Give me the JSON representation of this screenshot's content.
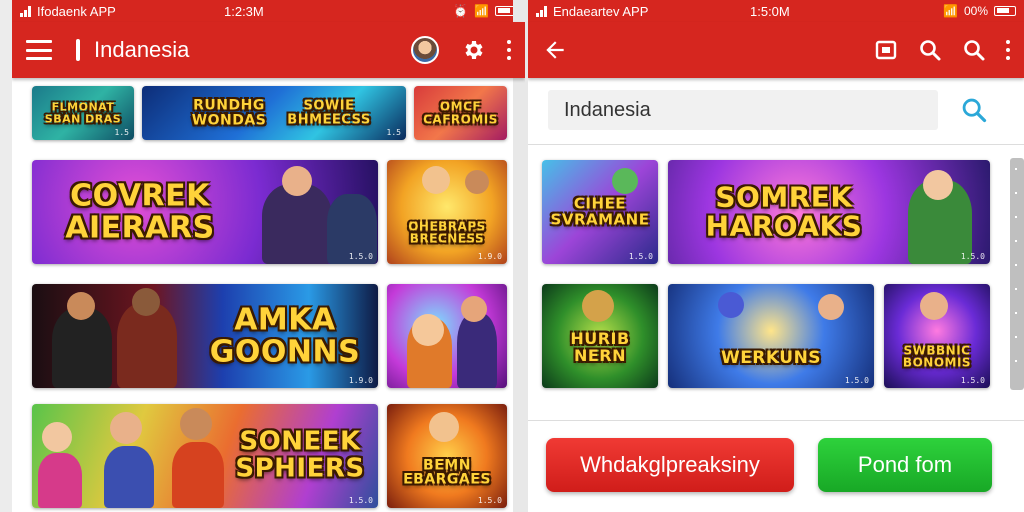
{
  "left_phone": {
    "status": {
      "app_label": "Ifodaenk APP",
      "time": "1:2:3M"
    },
    "appbar": {
      "title": "Indanesia",
      "menu_icon": "hamburger-icon",
      "settings_icon": "gear-icon",
      "more_icon": "kebab-icon"
    },
    "tiles": [
      {
        "title": "FLMONAT\nSBAN DRAS",
        "tag": "1.5"
      },
      {
        "title": "RUNDHG\nWONDAS",
        "tag": ""
      },
      {
        "title": "SOWIE\nBHMEECSS",
        "tag": "1.5"
      },
      {
        "title": "OMCF\nCAFROMIS",
        "tag": ""
      },
      {
        "title": "COVREK\nAIERARS",
        "tag": "1.5.0"
      },
      {
        "title": "OHEBRAPS\nBRECNESS",
        "tag": "1.9.0"
      },
      {
        "title": "AMKA\nGOONNS",
        "tag": "1.9.0"
      },
      {
        "title": "",
        "tag": ""
      },
      {
        "title": "SONEEK\nSPHIERS",
        "tag": "1.5.0"
      },
      {
        "title": "BEMN\nEBARGAES",
        "tag": "1.5.0"
      }
    ]
  },
  "right_phone": {
    "status": {
      "app_label": "Endaeartev APP",
      "time": "1:5:0M",
      "battery": "00%"
    },
    "appbar": {
      "back_icon": "arrow-left-icon",
      "screen_icon": "screen-icon",
      "search_icon": "search-icon",
      "search2_icon": "search-icon",
      "more_icon": "kebab-icon"
    },
    "search": {
      "value": "Indanesia",
      "icon": "search-icon"
    },
    "tiles": [
      {
        "title": "CIHEE\nSVRAMANE",
        "tag": "1.5.0"
      },
      {
        "title": "SOMREK\nHAROAKS",
        "tag": "1.5.0"
      },
      {
        "title": "HURIB\nNERN",
        "tag": ""
      },
      {
        "title": "WERKUNS",
        "tag": "1.5.0"
      },
      {
        "title": "SWBBNIC\nBONOMIS",
        "tag": "1.5.0"
      }
    ],
    "buttons": {
      "primary": "Whdakglpreaksiny",
      "secondary": "Pond fom"
    }
  }
}
